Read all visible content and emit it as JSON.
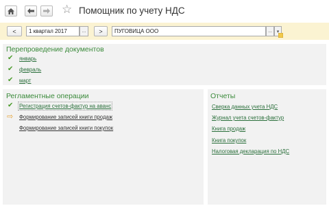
{
  "window": {
    "title": "Помощник по учету НДС",
    "home_icon": "home-icon",
    "back_icon": "arrow-left-icon",
    "forward_icon": "arrow-right-icon",
    "favorite_icon": "star-icon"
  },
  "toolbar": {
    "prev_label": "<",
    "period_value": "1 квартал 2017",
    "period_picker_label": "...",
    "next_label": ">",
    "organization_value": "ПУГОВИЦА ООО",
    "org_select_label": "...",
    "org_dropdown_icon": "chevron-down-icon",
    "org_open_icon": "open-icon"
  },
  "reprocessing": {
    "title": "Перепроведение документов",
    "items": [
      "январь",
      "февраль",
      "март"
    ]
  },
  "routine": {
    "title": "Регламентные операции",
    "items": [
      "Регистрация счетов-фактур на аванс",
      "Формирование записей книги продаж",
      "Формирование записей книги покупок"
    ]
  },
  "reports": {
    "title": "Отчеты",
    "items": [
      "Сверка данных учета НДС",
      "Журнал учета счетов-фактур",
      "Книга продаж",
      "Книга покупок",
      "Налоговая декларация по НДС"
    ]
  },
  "colors": {
    "accent_green": "#3a8a3a",
    "toolbar_bg": "#fbf3d2",
    "panel_bg": "#f2f2f2",
    "pending_arrow": "#e6a43a"
  }
}
